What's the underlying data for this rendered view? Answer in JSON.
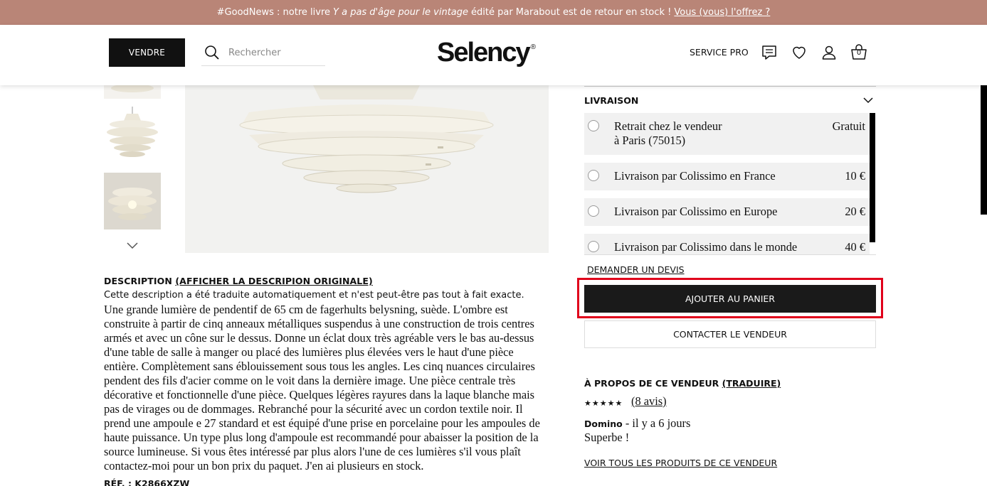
{
  "banner": {
    "prefix": "#GoodNews : notre livre",
    "book_title": "Y a pas d'âge pour le vintage",
    "suffix": "édité par Marabout est de retour en stock !",
    "link": "Vous (vous) l'offrez ?"
  },
  "header": {
    "sell_button": "VENDRE",
    "search_placeholder": "Rechercher",
    "logo": "Selency",
    "logo_mark": "®",
    "service_pro": "SERVICE PRO",
    "cart_count": "0"
  },
  "description": {
    "title": "DESCRIPTION",
    "show_original": "(AFFICHER LA DESCRIPION ORIGINALE)",
    "note": "Cette description a été traduite automatiquement et n'est peut-être pas tout à fait exacte.",
    "body": "Une grande lumière de pendentif de 65 cm de fagerhults belysning, suède. L'ombre est construite à partir de cinq anneaux métalliques suspendus à une construction de trois centres armés et avec un cône sur le dessus. Donne un éclat doux très agréable vers le bas au-dessus d'une table de salle à manger ou placé des lumières plus élevées vers le haut d'une pièce entière. Complètement sans éblouissement sous tous les angles. Les cinq nuances circulaires pendent des fils d'acier comme on le voit dans la dernière image. Une pièce centrale très décorative et fonctionnelle d'une pièce. Quelques légères rayures dans la laque blanche mais pas de virages ou de dommages. Rebranché pour la sécurité avec un cordon textile noir. Il prend une ampoule e 27 standard et est équipé d'une prise en porcelaine pour les ampoules de haute puissance. Un type plus long d'ampoule est recommandé pour abaisser la position de la source lumineuse. Si vous êtes intéressé par plus alors l'une de ces lumières s'il vous plaît contactez-moi pour un bon prix du paquet. J'en ai plusieurs en stock.",
    "ref": "RÉF. : K2866XZW"
  },
  "delivery": {
    "title": "LIVRAISON",
    "options": [
      {
        "label": "Retrait chez le vendeur",
        "label2": "à Paris (75015)",
        "price": "Gratuit"
      },
      {
        "label": "Livraison par Colissimo en France",
        "price": "10 €"
      },
      {
        "label": "Livraison par Colissimo en Europe",
        "price": "20 €"
      },
      {
        "label": "Livraison par Colissimo dans le monde",
        "price": "40 €"
      }
    ]
  },
  "actions": {
    "quote": "DEMANDER UN DEVIS",
    "add_to_cart": "AJOUTER AU PANIER",
    "contact_seller": "CONTACTER LE VENDEUR"
  },
  "seller": {
    "about": "À PROPOS DE CE VENDEUR",
    "translate": "(TRADUIRE)",
    "stars": "★★★★★",
    "rating": 4.5,
    "reviews": "(8 avis)",
    "review_author": "Domino",
    "review_time": "- il y a 6 jours",
    "review_text": "Superbe !",
    "all_products": "VOIR TOUS LES PRODUITS DE CE VENDEUR"
  },
  "colors": {
    "banner_bg": "#b98577",
    "highlight": "#e0001b",
    "primary_button": "#1a1a1a"
  }
}
